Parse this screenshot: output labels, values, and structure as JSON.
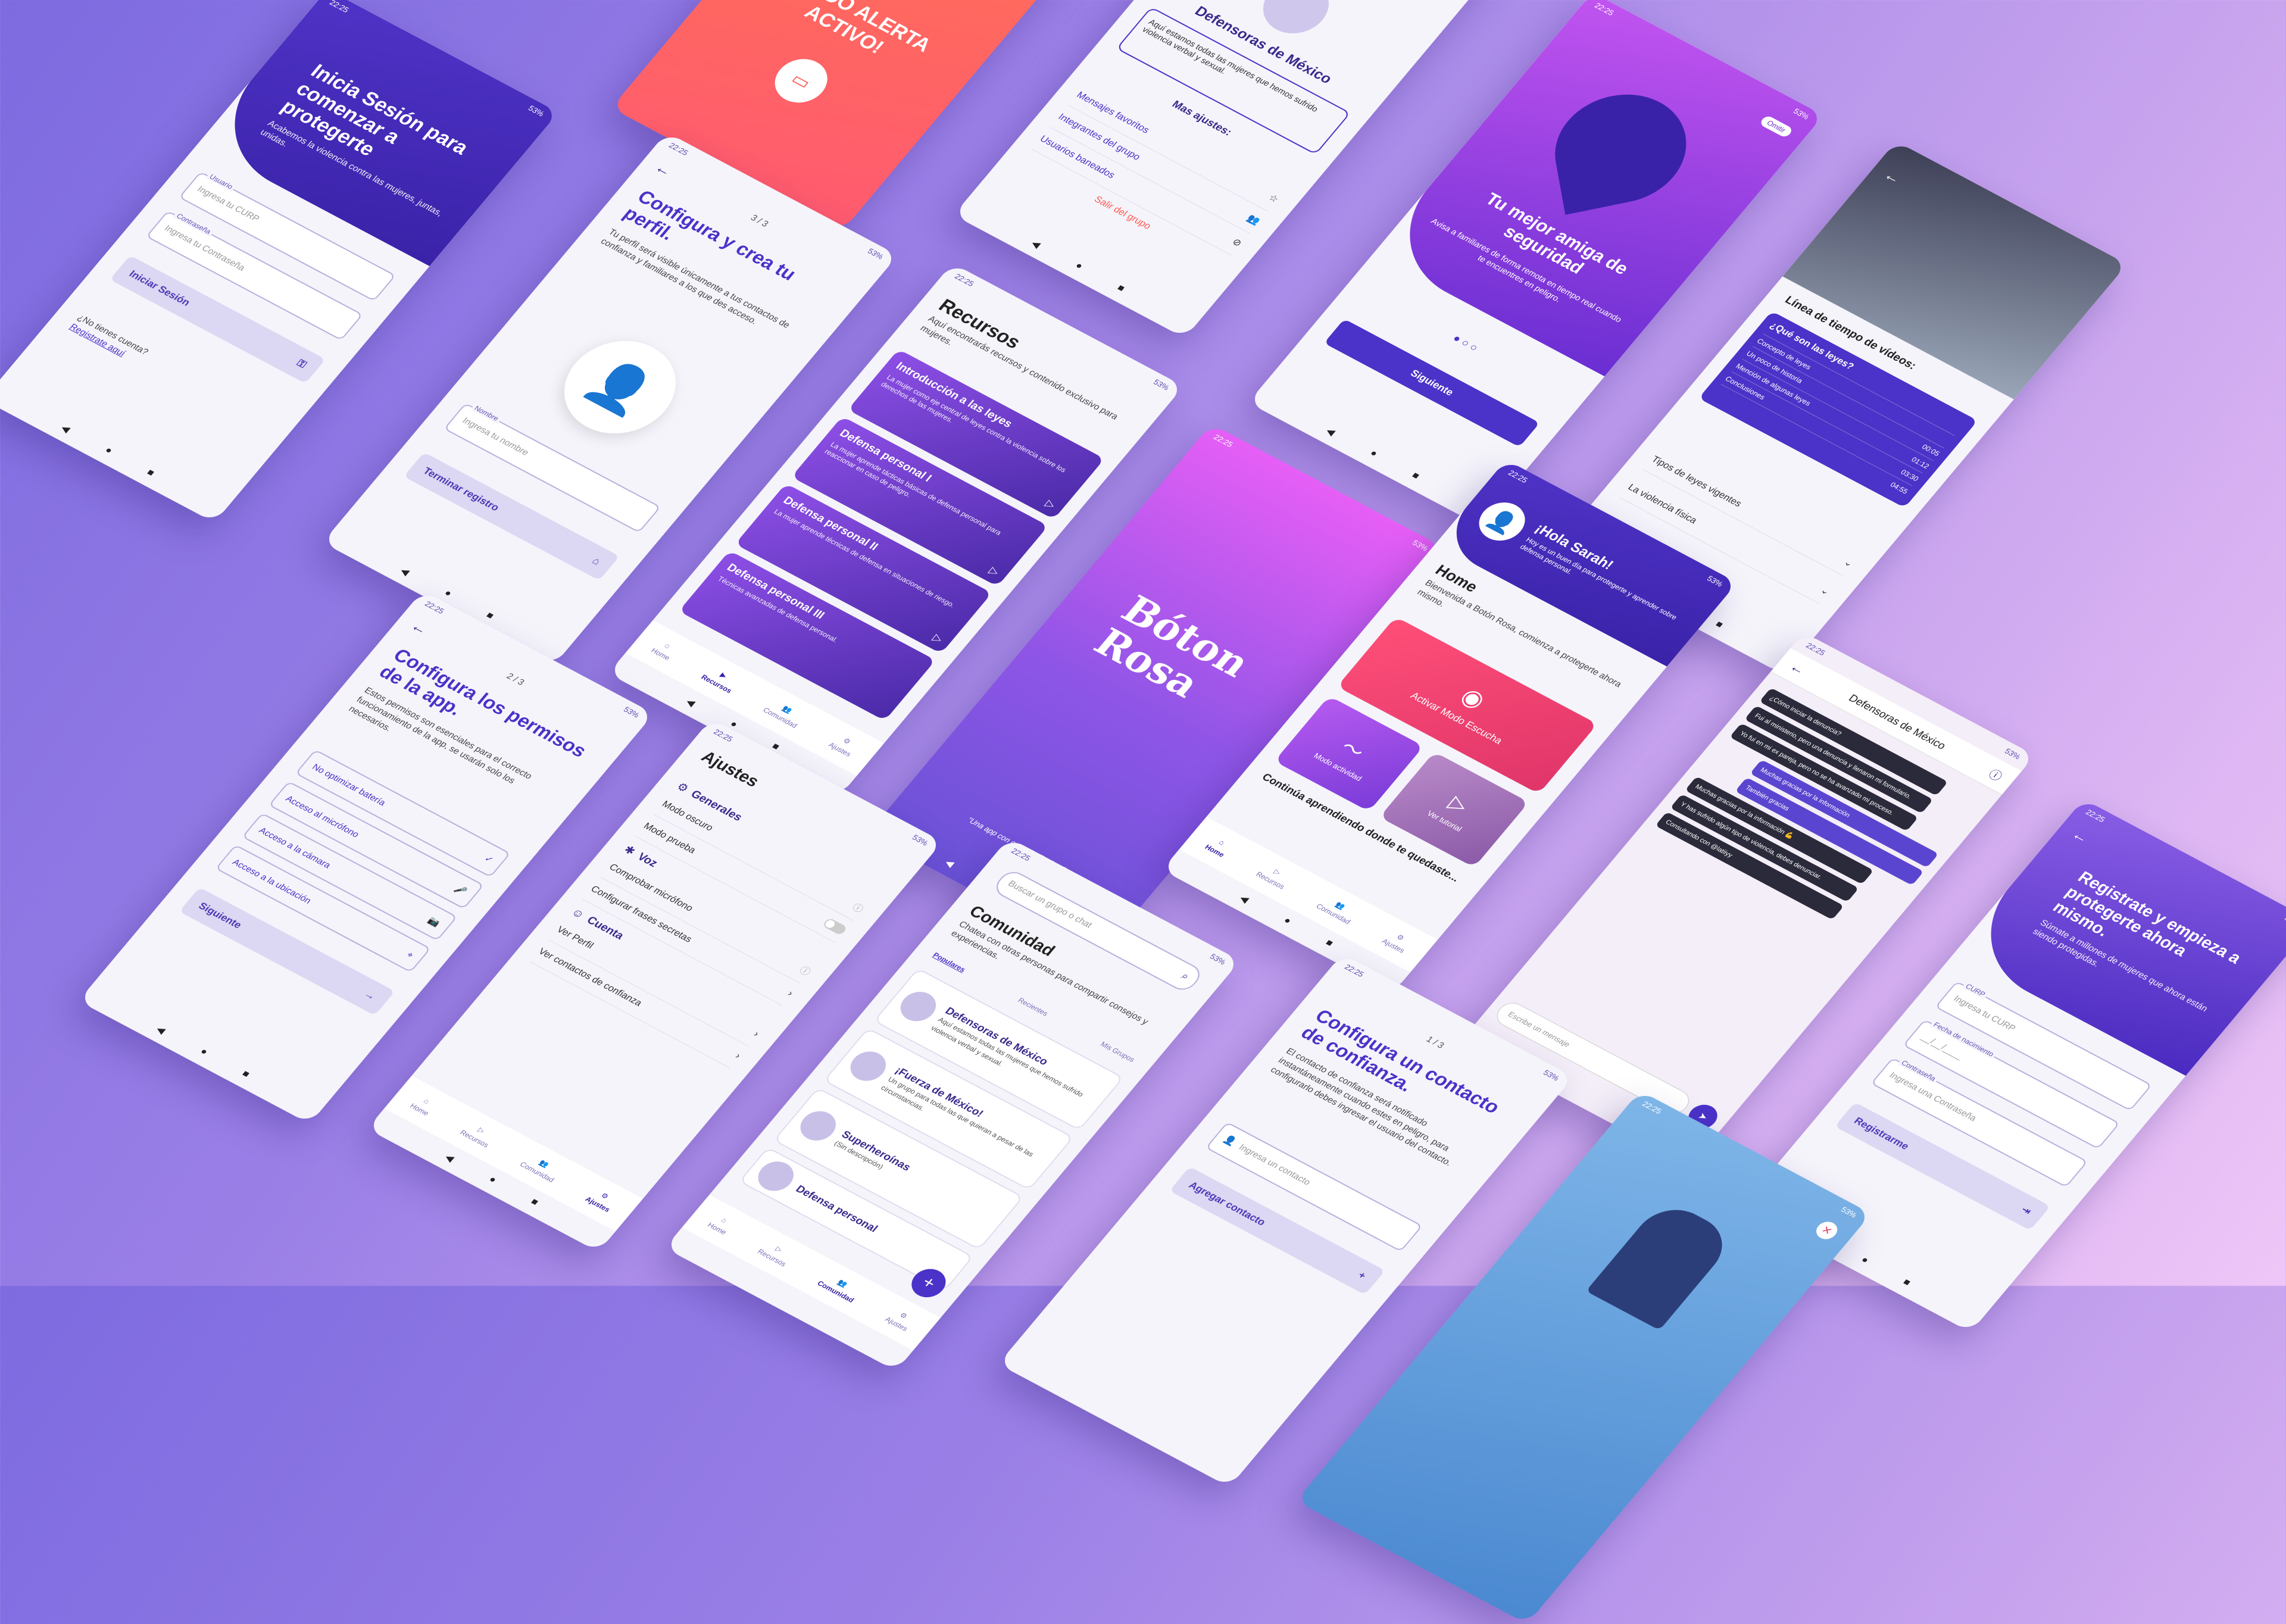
{
  "status": {
    "time": "22:25",
    "battery": "53%"
  },
  "login": {
    "title": "Inicia Sesión para comenzar a protegerte",
    "subtitle": "Acabemos la violencia contra las mujeres, juntas, unidas.",
    "user_label": "Usuario",
    "user_placeholder": "Ingresa tu CURP",
    "pass_label": "Contraseña",
    "pass_placeholder": "Ingresa tu Contraseña",
    "submit": "Iniciar Sesión",
    "no_account": "¿No tienes cuenta?",
    "register_link": "Registrate aquí"
  },
  "alert": {
    "title": "¡MODO ALERTA ACTIVO!"
  },
  "group": {
    "name": "Defensoras de México",
    "description": "Aquí estamos todas las mujeres que hemos sufrido violencia verbal y sexual.",
    "more": "Mas ajustes:",
    "items": [
      "Mensajes favoritos",
      "Integrantes del grupo",
      "Usuarios baneados"
    ],
    "leave": "Salir del grupo"
  },
  "onboarding": {
    "skip": "Omitir",
    "title": "Tu mejor amiga de seguridad",
    "text": "Avisa a familiares de forma remota en tiempo real cuando te encuentres en peligro.",
    "next": "Siguiente"
  },
  "profile": {
    "step": "3 / 3",
    "title": "Configura y crea tu perfil.",
    "text": "Tu perfil será visible únicamente a tus contactos de confianza y familiares a los que des acceso.",
    "name_label": "Nombre",
    "name_placeholder": "Ingresa tu nombre",
    "finish": "Terminar registro"
  },
  "resources": {
    "title": "Recursos",
    "subtitle": "Aquí encontrarás recursos y contenido exclusivo para mujeres.",
    "cards": [
      {
        "title": "Introducción a las leyes",
        "text": "La mujer como eje central de leyes contra la violencia sobre los derechos de las mujeres."
      },
      {
        "title": "Defensa personal I",
        "text": "La mujer aprende tácticas básicas de defensa personal para reaccionar en caso de peligro."
      },
      {
        "title": "Defensa personal II",
        "text": "La mujer aprende técnicas de defensa en situaciones de riesgo."
      },
      {
        "title": "Defensa personal III",
        "text": "Técnicas avanzadas de defensa personal."
      }
    ]
  },
  "nav": {
    "home": "Home",
    "resources": "Recursos",
    "community": "Comunidad",
    "settings": "Ajustes"
  },
  "timeline": {
    "title": "Línea de tiempo de vídeos:",
    "q1": "¿Qué son las leyes?",
    "entries": [
      {
        "label": "Concepto de leyes",
        "time": ""
      },
      {
        "label": "Un poco de historia",
        "time": "00:05"
      },
      {
        "label": "Mención de algunas leyes",
        "time": "01:12"
      },
      {
        "label": "Conclusiones",
        "time": "03:30"
      },
      {
        "label": "",
        "time": "04:55"
      }
    ],
    "q2": "Tipos de leyes vigentes",
    "q3": "La violencia física"
  },
  "splash": {
    "brand": "Bóton Rosa",
    "tagline": "\"Una app con causa\" - Equipo Rosa"
  },
  "home": {
    "greeting": "¡Hola Sarah!",
    "greeting_sub": "Hoy es un buen día para protegerte y aprender sobre defensa personal.",
    "title": "Home",
    "text": "Bienvenida a Botón Rosa, comienza a protegerte ahora mismo.",
    "listen": "Activar Modo Escucha",
    "activity": "Modo actividad",
    "tutorial": "Ver tutorial",
    "continue": "Continúa aprendiendo donde te quedaste..."
  },
  "permissions": {
    "step": "2 / 3",
    "title": "Configura los permisos de la app.",
    "text": "Estos permisos son esenciales para el correcto funcionamiento de la app, se usarán solo los necesarios.",
    "options": [
      "No optimizar batería",
      "Acceso al micrófono",
      "Acceso a la cámara",
      "Acceso a la ubicación"
    ],
    "next": "Siguiente"
  },
  "settings": {
    "title": "Ajustes",
    "general": "Generales",
    "dark": "Modo oscuro",
    "test": "Modo prueba",
    "voice": "Voz",
    "mic": "Comprobar micrófono",
    "phrases": "Configurar frases secretas",
    "account": "Cuenta",
    "profile": "Ver Perfil",
    "trusted": "Ver contactos de confianza"
  },
  "community": {
    "search": "Buscar un grupo o chat",
    "title": "Comunidad",
    "text": "Chatea con otras personas para compartir consejos y experiencias.",
    "tabs": [
      "Populares",
      "Recientes",
      "Mis Grupos"
    ],
    "groups": [
      {
        "name": "Defensoras de México",
        "desc": "Aquí estamos todas las mujeres que hemos sufrido violencia verbal y sexual."
      },
      {
        "name": "¡Fuerza de México!",
        "desc": "Un grupo para todas las que quieran a pesar de las circunstancias."
      },
      {
        "name": "Superheroínas",
        "desc": "(Sin descripción)"
      },
      {
        "name": "Defensa personal",
        "desc": ""
      }
    ]
  },
  "chat": {
    "title": "Defensoras de México",
    "messages": [
      {
        "dir": "in",
        "text": "¿Cómo iniciar la denuncia?"
      },
      {
        "dir": "in",
        "text": "Fui al ministerio, pero una denuncia y llenaron mi formulario."
      },
      {
        "dir": "in",
        "text": "Yo fui en mi ex pareja, pero no se ha avanzado mi proceso."
      },
      {
        "dir": "out",
        "text": "Muchas gracias por la información"
      },
      {
        "dir": "out",
        "text": "También gracias"
      },
      {
        "dir": "in",
        "text": "Muchas gracias por la información 💪"
      },
      {
        "dir": "in",
        "text": "Y has sufrido algún tipo de violencia, debes denunciar."
      },
      {
        "dir": "in",
        "text": "Consultando con @latiiyy"
      }
    ],
    "placeholder": "Escribe un mensaje"
  },
  "register": {
    "title": "Registrate y empieza a protegerte ahora mismo.",
    "text": "Súmate a millones de mujeres que ahora están siendo protegidas.",
    "curp_label": "CURP",
    "curp_placeholder": "Ingresa tu CURP",
    "birth_label": "Fecha de nacimiento",
    "birth_placeholder": "__/__/____",
    "pass_label": "Contraseña",
    "pass_placeholder": "Ingresa una Contraseña",
    "submit": "Registrarme"
  },
  "contact": {
    "step": "1 / 3",
    "title": "Configura un contacto de confianza.",
    "text": "El contacto de confianza será notificado instantáneamente cuando estes en peligro, para configurarlo debes ingresar el usuario del contacto.",
    "user_placeholder": "Ingresa un contacto",
    "add": "Agregar contacto"
  }
}
